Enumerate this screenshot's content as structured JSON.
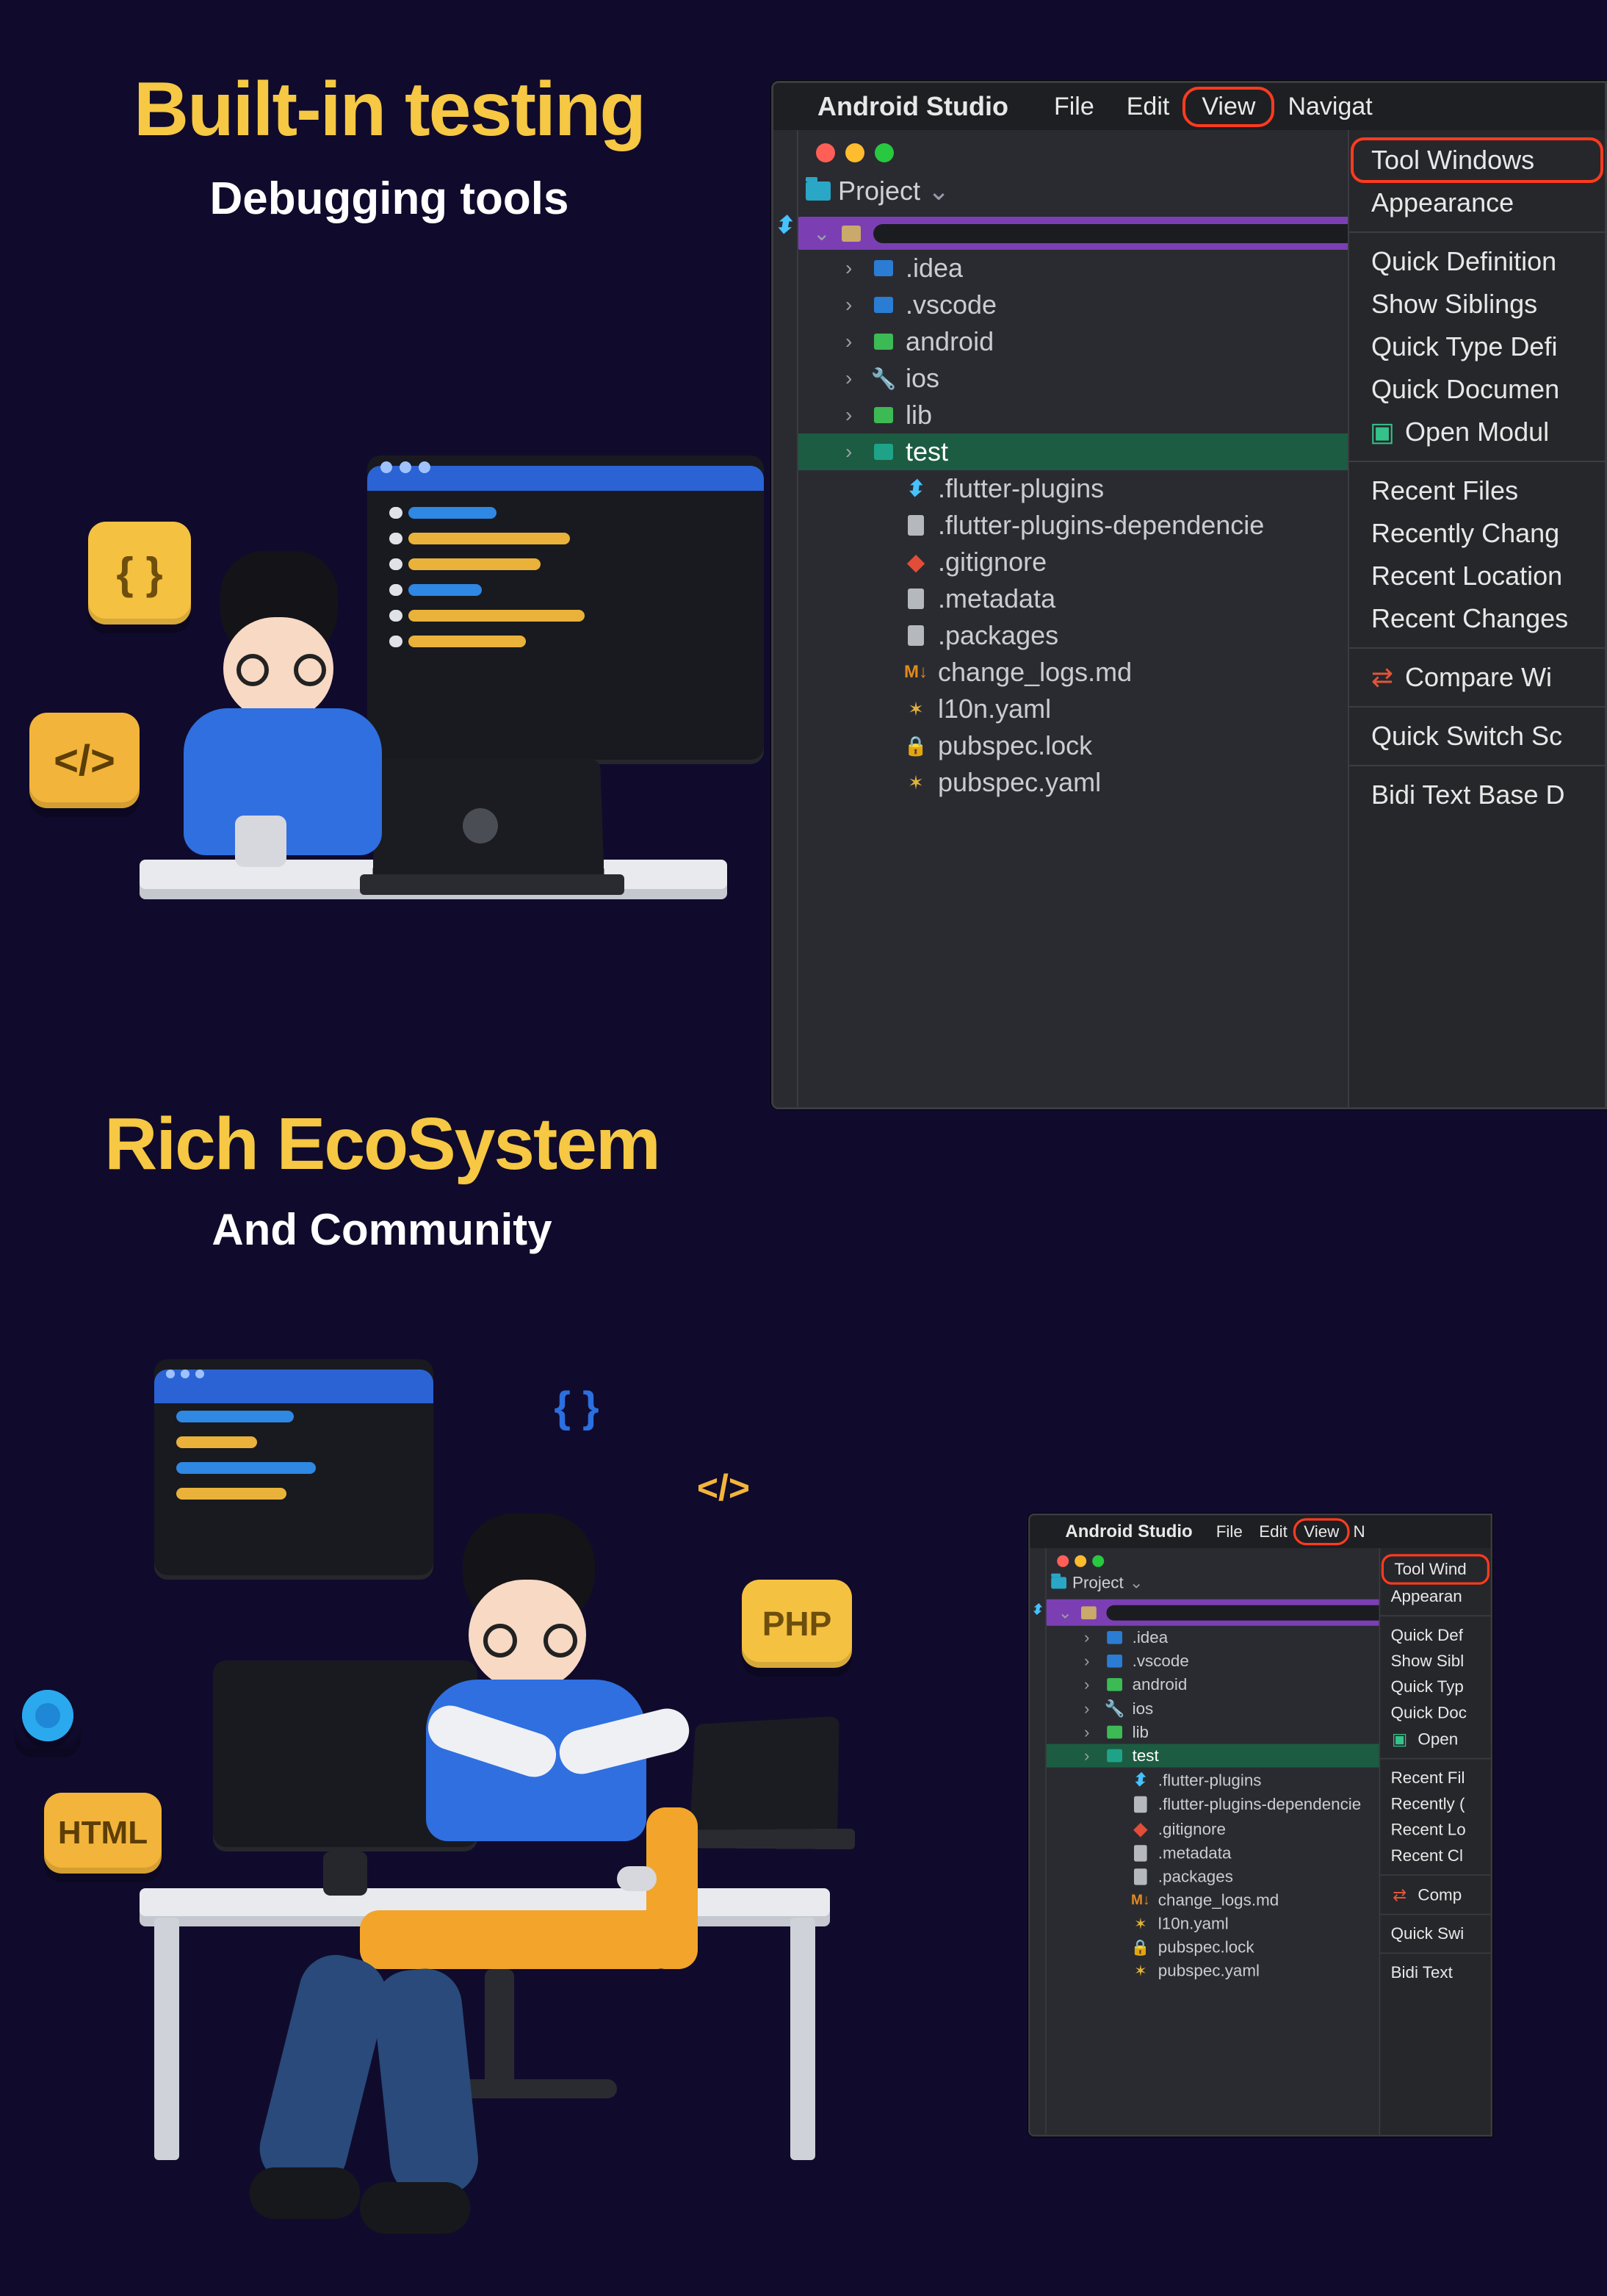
{
  "section1": {
    "title": "Built-in testing",
    "subtitle": "Debugging tools"
  },
  "section2": {
    "title": "Rich EcoSystem",
    "subtitle": "And Community"
  },
  "badges": {
    "braces": "{ }",
    "code": "</>",
    "html": "HTML",
    "php": "PHP",
    "braces2": "{ }",
    "code2": "</>"
  },
  "ide": {
    "app": "Android Studio",
    "menus": [
      "File",
      "Edit",
      "View",
      "Navigat"
    ],
    "activeMenu": "View",
    "project_label": "Project",
    "dropdown": [
      {
        "label": "Tool Windows",
        "highlight": true
      },
      {
        "label": "Appearance"
      },
      {
        "sep": true
      },
      {
        "label": "Quick Definition"
      },
      {
        "label": "Show Siblings"
      },
      {
        "label": "Quick Type Defi"
      },
      {
        "label": "Quick Documen"
      },
      {
        "label": "Open Modul",
        "icon": "module"
      },
      {
        "sep": true
      },
      {
        "label": "Recent Files"
      },
      {
        "label": "Recently Chang"
      },
      {
        "label": "Recent Location"
      },
      {
        "label": "Recent Changes"
      },
      {
        "sep": true
      },
      {
        "label": "Compare Wi",
        "icon": "compare"
      },
      {
        "sep": true
      },
      {
        "label": "Quick Switch Sc"
      },
      {
        "sep": true
      },
      {
        "label": "Bidi Text Base D"
      }
    ],
    "tree": [
      {
        "kind": "root"
      },
      {
        "label": ".idea",
        "icon": "folder-blue",
        "indent": 2,
        "arrow": ">"
      },
      {
        "label": ".vscode",
        "icon": "folder-blue",
        "indent": 2,
        "arrow": ">"
      },
      {
        "label": "android",
        "icon": "folder-green",
        "indent": 2,
        "arrow": ">"
      },
      {
        "label": "ios",
        "icon": "wrench",
        "indent": 2,
        "arrow": ">"
      },
      {
        "label": "lib",
        "icon": "folder-green",
        "indent": 2,
        "arrow": ">"
      },
      {
        "label": "test",
        "icon": "folder-teal",
        "indent": 2,
        "arrow": ">",
        "selected": true
      },
      {
        "label": ".flutter-plugins",
        "icon": "flutter",
        "indent": 3
      },
      {
        "label": ".flutter-plugins-dependencie",
        "icon": "doc",
        "indent": 3
      },
      {
        "label": ".gitignore",
        "icon": "git",
        "indent": 3
      },
      {
        "label": ".metadata",
        "icon": "doc",
        "indent": 3
      },
      {
        "label": ".packages",
        "icon": "doc",
        "indent": 3
      },
      {
        "label": "change_logs.md",
        "icon": "md",
        "indent": 3
      },
      {
        "label": "l10n.yaml",
        "icon": "yaml",
        "indent": 3
      },
      {
        "label": "pubspec.lock",
        "icon": "lock",
        "indent": 3
      },
      {
        "label": "pubspec.yaml",
        "icon": "yaml",
        "indent": 3
      }
    ]
  },
  "ide2": {
    "app": "Android Studio",
    "menus": [
      "File",
      "Edit",
      "View",
      "N"
    ],
    "activeMenu": "View",
    "project_label": "Project",
    "dropdown": [
      {
        "label": "Tool Wind",
        "highlight": true
      },
      {
        "label": "Appearan"
      },
      {
        "sep": true
      },
      {
        "label": "Quick Def"
      },
      {
        "label": "Show Sibl"
      },
      {
        "label": "Quick Typ"
      },
      {
        "label": "Quick Doc"
      },
      {
        "label": "Open",
        "icon": "module"
      },
      {
        "sep": true
      },
      {
        "label": "Recent Fil"
      },
      {
        "label": "Recently ("
      },
      {
        "label": "Recent Lo"
      },
      {
        "label": "Recent Cl"
      },
      {
        "sep": true
      },
      {
        "label": "Comp",
        "icon": "compare"
      },
      {
        "sep": true
      },
      {
        "label": "Quick Swi"
      },
      {
        "sep": true
      },
      {
        "label": "Bidi Text"
      }
    ],
    "tree": [
      {
        "kind": "root"
      },
      {
        "label": ".idea",
        "icon": "folder-blue",
        "indent": 2,
        "arrow": ">"
      },
      {
        "label": ".vscode",
        "icon": "folder-blue",
        "indent": 2,
        "arrow": ">"
      },
      {
        "label": "android",
        "icon": "folder-green",
        "indent": 2,
        "arrow": ">"
      },
      {
        "label": "ios",
        "icon": "wrench",
        "indent": 2,
        "arrow": ">"
      },
      {
        "label": "lib",
        "icon": "folder-green",
        "indent": 2,
        "arrow": ">"
      },
      {
        "label": "test",
        "icon": "folder-teal",
        "indent": 2,
        "arrow": ">",
        "selected": true
      },
      {
        "label": ".flutter-plugins",
        "icon": "flutter",
        "indent": 3
      },
      {
        "label": ".flutter-plugins-dependencie",
        "icon": "doc",
        "indent": 3
      },
      {
        "label": ".gitignore",
        "icon": "git",
        "indent": 3
      },
      {
        "label": ".metadata",
        "icon": "doc",
        "indent": 3
      },
      {
        "label": ".packages",
        "icon": "doc",
        "indent": 3
      },
      {
        "label": "change_logs.md",
        "icon": "md",
        "indent": 3
      },
      {
        "label": "l10n.yaml",
        "icon": "yaml",
        "indent": 3
      },
      {
        "label": "pubspec.lock",
        "icon": "lock",
        "indent": 3
      },
      {
        "label": "pubspec.yaml",
        "icon": "yaml",
        "indent": 3
      }
    ]
  }
}
